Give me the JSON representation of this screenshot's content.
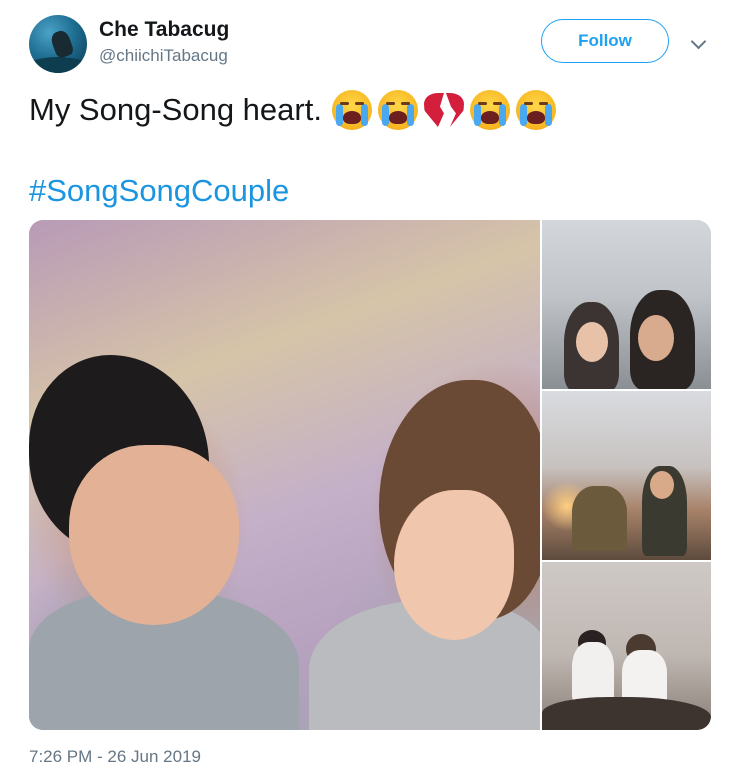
{
  "user": {
    "name": "Che Tabacug",
    "handle": "@chiichiTabacug",
    "avatar_icon": "scuba-diver-avatar"
  },
  "header": {
    "follow_label": "Follow",
    "menu_icon": "chevron-down-icon"
  },
  "tweet": {
    "text": "My Song-Song heart.",
    "emojis": [
      "loudly-crying-face",
      "loudly-crying-face",
      "broken-heart",
      "loudly-crying-face",
      "loudly-crying-face"
    ],
    "hashtag": "#SongSongCouple",
    "photo_count": 4,
    "timestamp": "7:26 PM - 26 Jun 2019"
  },
  "colors": {
    "accent": "#1da1f2",
    "hashtag": "#1b95e0",
    "secondary_text": "#657786",
    "primary_text": "#14171a"
  }
}
